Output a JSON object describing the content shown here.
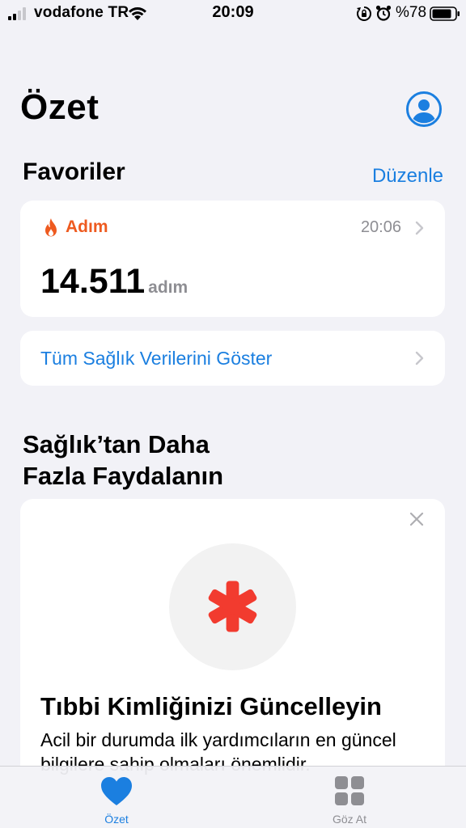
{
  "status_bar": {
    "carrier": "vodafone TR",
    "time": "20:09",
    "battery_percent": "%78",
    "icons": [
      "signal-icon",
      "wifi-icon",
      "orientation-lock-icon",
      "alarm-icon",
      "battery-icon"
    ]
  },
  "header": {
    "title": "Özet",
    "profile_icon": "person-circle-icon"
  },
  "favorites": {
    "title": "Favoriler",
    "edit_label": "Düzenle",
    "steps_card": {
      "icon": "flame-icon",
      "label": "Adım",
      "time": "20:06",
      "value": "14.511",
      "unit": "adım"
    },
    "show_all_label": "Tüm Sağlık Verilerini Göster"
  },
  "promo": {
    "section_title_line1": "Sağlık’tan Daha",
    "section_title_line2": "Fazla Faydalanın",
    "icon": "medical-id-asterisk-icon",
    "heading": "Tıbbi Kimliğinizi Güncelleyin",
    "body": "Acil bir durumda ilk yardımcıların en güncel bilgilere sahip olmaları önemlidir."
  },
  "tab_bar": {
    "tabs": [
      {
        "label": "Özet",
        "icon": "heart-icon",
        "active": true
      },
      {
        "label": "Göz At",
        "icon": "grid-icon",
        "active": false
      }
    ]
  },
  "colors": {
    "accent": "#1b7fe0",
    "steps_orange": "#ee5a1f",
    "medical_red": "#f23b2f",
    "background": "#f2f2f7"
  }
}
